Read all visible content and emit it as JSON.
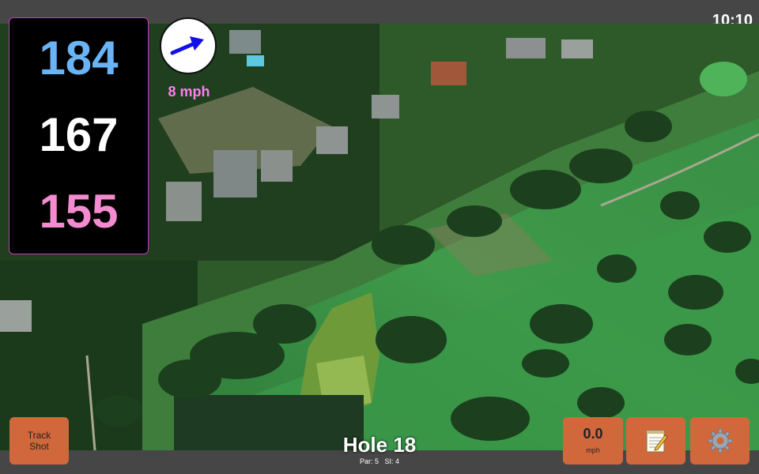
{
  "status": {
    "clock": "10:10"
  },
  "distances": {
    "back": "184",
    "middle": "167",
    "front": "155",
    "colors": {
      "back": "#6ab4f5",
      "middle": "#ffffff",
      "front": "#f48ad0"
    }
  },
  "wind": {
    "speed": "8 mph",
    "speed_color": "#ff7ef0",
    "arrow_icon": "arrow-right-icon",
    "arrow_color": "#1010e8"
  },
  "hole": {
    "title": "Hole 18",
    "par": "Par: 5",
    "si": "SI: 4"
  },
  "buttons": {
    "track_shot_line1": "Track",
    "track_shot_line2": "Shot",
    "speed_value": "0.0",
    "speed_unit": "mph",
    "notes_icon": "notepad-icon",
    "settings_icon": "gear-icon",
    "accent": "#d1683c"
  }
}
